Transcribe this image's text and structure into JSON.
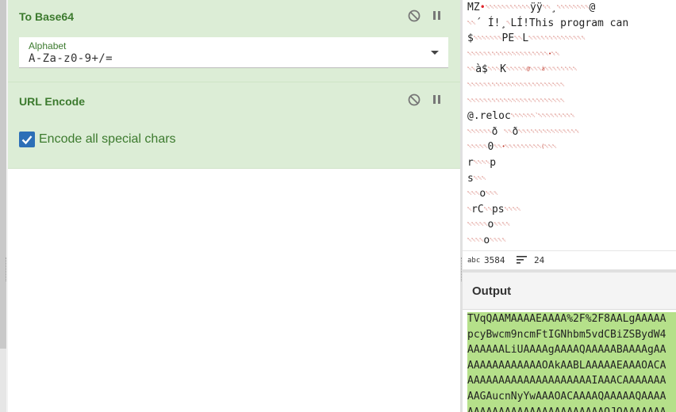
{
  "recipe": {
    "operations": [
      {
        "title": "To Base64",
        "field_label": "Alphabet",
        "field_value": "A-Za-z0-9+/=",
        "icons": [
          "disable-icon",
          "pause-icon"
        ]
      },
      {
        "title": "URL Encode",
        "checkbox_label": "Encode all special chars",
        "checkbox_checked": true,
        "icons": [
          "disable-icon",
          "pause-icon"
        ]
      }
    ]
  },
  "input": {
    "lines": [
      {
        "pre": "MZ",
        "dot": "•",
        "ctrl": "␀␀␀␀␀␀␀␀␀␀␀",
        "post": "ÿÿ",
        "ctrl2": "␀␀",
        "tail": "¸",
        "ctrl3": "␀␀␀␀␀␀␀␀",
        "end": "@"
      },
      {
        "pre": "",
        "dot": "",
        "ctrl": "␀␀",
        "post": "´      Í!¸",
        "ctrl2": "␀",
        "tail": "LÍ!This program can",
        "ctrl3": "",
        "end": ""
      },
      {
        "pre": "$",
        "dot": "",
        "ctrl": "␀␀␀␀␀␀␀",
        "post": "PE",
        "ctrl2": "␀␀",
        "tail": "L",
        "ctrl3": "␀␀␀␀␀␀␀␀␀␀␀␀␀␀",
        "end": ""
      },
      {
        "pre": "",
        "dot": "",
        "ctrl": "␀␀␀␀␀␀␀␀␀␀␀␀␀␀␀␀␀␀␀␀",
        "post": "",
        "ctrl2": "",
        "tail": "",
        "ctrl3": "•␀␀",
        "end": ""
      },
      {
        "pre": "",
        "dot": "",
        "ctrl": "␀␀",
        "post": "à$",
        "ctrl2": "␀␀␀",
        "tail": "K",
        "ctrl3": "␀␀␀␀␀@␀␀␀à␀␀␀␀␀␀␀␀",
        "end": ""
      },
      {
        "pre": "",
        "dot": "",
        "ctrl": "␀␀␀␀␀␀␀␀␀␀␀␀␀␀␀␀␀␀␀␀␀␀␀␀",
        "post": "",
        "ctrl2": "",
        "tail": "",
        "ctrl3": "",
        "end": ""
      },
      {
        "pre": "",
        "dot": "",
        "ctrl": "␀␀␀␀␀␀␀␀␀␀␀␀␀␀␀␀␀␀␀␀␀␀␀␀",
        "post": "",
        "ctrl2": "",
        "tail": "",
        "ctrl3": "",
        "end": ""
      },
      {
        "pre": "@.reloc",
        "dot": "",
        "ctrl": "␀␀␀␀␀␀`␀␀␀␀␀␀␀␀␀",
        "post": "",
        "ctrl2": "",
        "tail": "",
        "ctrl3": "",
        "end": ""
      },
      {
        "pre": "",
        "dot": "",
        "ctrl": "␀␀␀␀␀␀",
        "post": "ð ",
        "ctrl2": "␀␀",
        "tail": "ð",
        "ctrl3": "␀␀␀␀␀␀␀␀␀␀␀␀␀␀␀",
        "end": ""
      },
      {
        "pre": "",
        "dot": "",
        "ctrl": "␀␀␀␀␀",
        "post": "0",
        "ctrl2": "␀␀",
        "tail": "",
        "ctrl3": "•␀␀␀␀␀␀␀␀␀(␀␀␀",
        "end": ""
      },
      {
        "pre": "r",
        "dot": "",
        "ctrl": "␀␀␀␀",
        "post": "p",
        "ctrl2": "",
        "tail": "",
        "ctrl3": "",
        "end": ""
      },
      {
        "pre": "s",
        "dot": "",
        "ctrl": "␀␀␀",
        "post": "",
        "ctrl2": "",
        "tail": "",
        "ctrl3": "",
        "end": ""
      },
      {
        "pre": "",
        "dot": "",
        "ctrl": "␀␀␀",
        "post": "o",
        "ctrl2": "␀␀␀",
        "tail": "",
        "ctrl3": "",
        "end": ""
      },
      {
        "pre": "",
        "dot": "",
        "ctrl": "␀",
        "post": "rC",
        "ctrl2": "␀␀",
        "tail": "ps",
        "ctrl3": "␀␀␀␀",
        "end": ""
      },
      {
        "pre": "",
        "dot": "",
        "ctrl": "␀␀␀␀␀",
        "post": "o",
        "ctrl2": "␀␀␀␀",
        "tail": "",
        "ctrl3": "",
        "end": ""
      },
      {
        "pre": "",
        "dot": "",
        "ctrl": "␀␀␀␀",
        "post": "o",
        "ctrl2": "␀␀␀␀",
        "tail": "",
        "ctrl3": "",
        "end": ""
      }
    ],
    "length_icon": "abc",
    "length": "3584",
    "lines_icon": "lines-icon",
    "line_count": "24"
  },
  "output": {
    "title": "Output",
    "lines": [
      "TVqQAAMAAAAEAAAA%2F%2F8AALgAAAAA",
      "pcyBwcm9ncmFtIGNhbm5vdCBiZSBydW4",
      "AAAAAALiUAAAAgAAAAQAAAAABAAAAgAA",
      "AAAAAAAAAAAAOAkAABLAAAAAEAAAOACA",
      "AAAAAAAAAAAAAAAAAAAAIAAACAAAAAAA",
      "AAGAucnNyYwAAAOACAAAAQAAAAAQAAAA",
      "AAAAAAAAAAAAAAAAAAAAAAQJQAAAAAAA"
    ]
  },
  "colors": {
    "op_bg": "#dcedd6",
    "op_title": "#3c7a2e",
    "checkbox": "#2c6fb7",
    "output_highlight": "#b5e08a",
    "control_char": "#c0392b"
  }
}
